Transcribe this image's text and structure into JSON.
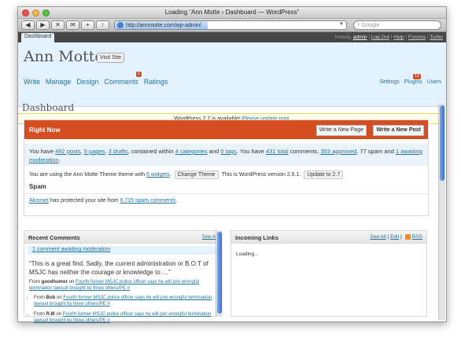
{
  "window": {
    "title": "Loading “Ann Motte › Dashboard — WordPress”"
  },
  "browser": {
    "url": "http://annmotte.com/wp-admin/",
    "search_placeholder": "Google",
    "buttons": [
      "◀",
      "▶",
      "✕",
      "✉",
      "+",
      "↑"
    ]
  },
  "wpbar": {
    "tab": "Dashboard",
    "howdy": "Howdy,",
    "user": "admin",
    "links": [
      "Log Out",
      "Help",
      "Forums",
      "Turbo"
    ],
    "sep": "|"
  },
  "header": {
    "site_title": "Ann Motte",
    "visit_site": "Visit Site",
    "nav": [
      "Write",
      "Manage",
      "Design",
      "Comments",
      "Ratings"
    ],
    "comments_badge": "1",
    "subnav": [
      "Settings",
      "Plugins",
      "Users"
    ],
    "plugins_badge": "13"
  },
  "notice": {
    "text": "WordPress 2.7 is available! ",
    "link": "Please update now",
    "end": "."
  },
  "page_title": "Dashboard",
  "right_now": {
    "title": "Right Now",
    "btn_page": "Write a New Page",
    "btn_post": "Write a New Post",
    "t1": "You have ",
    "posts": "492 posts",
    "t2": ", ",
    "pages": "5 pages",
    "t3": ", ",
    "drafts": "3 drafts",
    "t4": ", contained within ",
    "categories": "4 categories",
    "t5": " and ",
    "tags": "0 tags",
    "t6": ". You have ",
    "total": "431 total",
    "t7": " comments, ",
    "approved": "353 approved",
    "t8": ", 77 spam and ",
    "awaiting": "1 awaiting moderation",
    "t9": ".",
    "theme_text": "You are using the Ann Motte Theme theme with ",
    "widgets": "6 widgets",
    "theme_end": ".",
    "change_theme": "Change Theme",
    "version_text": "This is WordPress version 2.6.1.",
    "update_btn": "Update to 2.7",
    "spam_heading": "Spam",
    "akismet": "Akismet",
    "akismet_text": " has protected your site from ",
    "spam_count": "6,715 spam comments",
    "akismet_end": "."
  },
  "recent_comments": {
    "title": "Recent Comments",
    "see_all": "See All",
    "awaiting": "1 comment awaiting moderation",
    "quote": "“This is a great find. Sadly, the current administration or B.O.T of MSJC has neither the courage or knowledge to …”",
    "from_label": "From ",
    "from_author": "goodhumor",
    "on_label": " on ",
    "post_link": "Fourth former MSJC police officer says he will join wrongful termination lawsuit brought by three others/PE",
    "hash": " #",
    "items": [
      {
        "from": "From ",
        "author": "Bob",
        "on": " on ",
        "link": "Fourth former MSJC police officer says he will join wrongful termination lawsuit brought by three others/PE",
        "hash": " #"
      },
      {
        "from": "From ",
        "author": "R.M",
        "on": " on ",
        "link": "Fourth former MSJC police officer says he will join wrongful termination lawsuit brought by three others/PE",
        "hash": " #"
      }
    ]
  },
  "incoming_links": {
    "title": "Incoming Links",
    "see_all": "See All",
    "edit": "Edit",
    "rss": "RSS",
    "sep": "|",
    "loading": "Loading..."
  },
  "colors": {
    "accent": "#d54e21",
    "header_bg": "#e4f2fd",
    "link": "#21759b",
    "admin_bar": "#464646"
  }
}
